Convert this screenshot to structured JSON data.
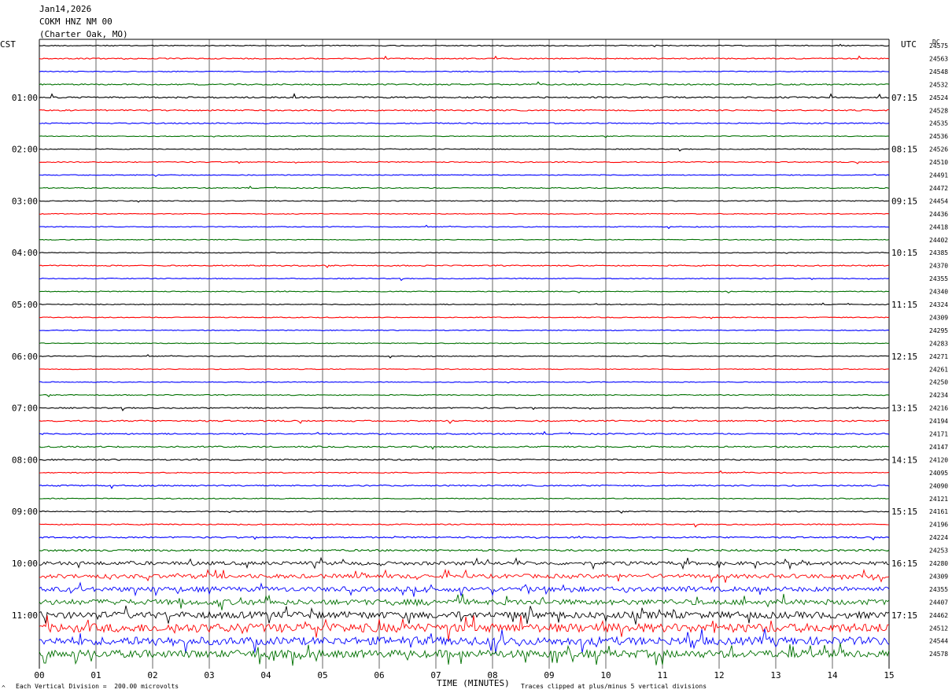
{
  "header": {
    "date": "Jan14,2026",
    "station": "COKM HNZ NM 00",
    "location": "(Charter Oak, MO)"
  },
  "left_axis_title": "CST",
  "right_axis_title": "UTC",
  "dc_title": "DC",
  "footer": {
    "vertical_division": "Each Vertical Division =  200.00 microvolts",
    "clip_note": "Traces clipped at plus/minus 5 vertical divisions",
    "corner_mark": "^"
  },
  "colors": {
    "trace_cycle": [
      "#000000",
      "#ff0000",
      "#0000ff",
      "#007000"
    ],
    "grid": "#000000"
  },
  "chart_data": {
    "type": "line",
    "title": "Jan14,2026",
    "xlabel": "TIME (MINUTES)",
    "xlim": [
      0,
      15
    ],
    "x_ticks": [
      "00",
      "01",
      "02",
      "03",
      "04",
      "05",
      "06",
      "07",
      "08",
      "09",
      "10",
      "11",
      "12",
      "13",
      "14",
      "15"
    ],
    "grid": true,
    "left_time_labels": [
      "01:00",
      "02:00",
      "03:00",
      "04:00",
      "05:00",
      "06:00",
      "07:00",
      "08:00",
      "09:00",
      "10:00",
      "11:00"
    ],
    "right_time_labels": [
      "07:15",
      "08:15",
      "09:15",
      "10:15",
      "11:15",
      "12:15",
      "13:15",
      "14:15",
      "15:15",
      "16:15",
      "17:15"
    ],
    "dc_offsets": [
      "24575",
      "24563",
      "24548",
      "24532",
      "24524",
      "24528",
      "24535",
      "24536",
      "24526",
      "24510",
      "24491",
      "24472",
      "24454",
      "24436",
      "24418",
      "24402",
      "24385",
      "24370",
      "24355",
      "24340",
      "24324",
      "24309",
      "24295",
      "24283",
      "24271",
      "24261",
      "24250",
      "24234",
      "24216",
      "24194",
      "24171",
      "24147",
      "24120",
      "24095",
      "24090",
      "24121",
      "24161",
      "24196",
      "24224",
      "24253",
      "24280",
      "24309",
      "24355",
      "24407",
      "24462",
      "24512",
      "24544",
      "24578"
    ],
    "trace_noise_level": [
      0.6,
      0.7,
      0.5,
      0.8,
      0.9,
      0.8,
      0.7,
      0.5,
      0.5,
      0.6,
      0.5,
      0.6,
      0.5,
      0.5,
      0.5,
      0.5,
      0.5,
      0.7,
      0.5,
      0.5,
      0.5,
      0.5,
      0.5,
      0.5,
      0.5,
      0.5,
      0.5,
      0.6,
      0.7,
      0.9,
      0.8,
      0.9,
      0.8,
      0.6,
      0.8,
      0.6,
      0.6,
      0.7,
      0.9,
      1.2,
      2.2,
      2.6,
      3.0,
      3.4,
      4.2,
      5.5,
      5.0,
      4.8
    ],
    "minutes_per_line": 15,
    "series_unit": "microvolts"
  }
}
